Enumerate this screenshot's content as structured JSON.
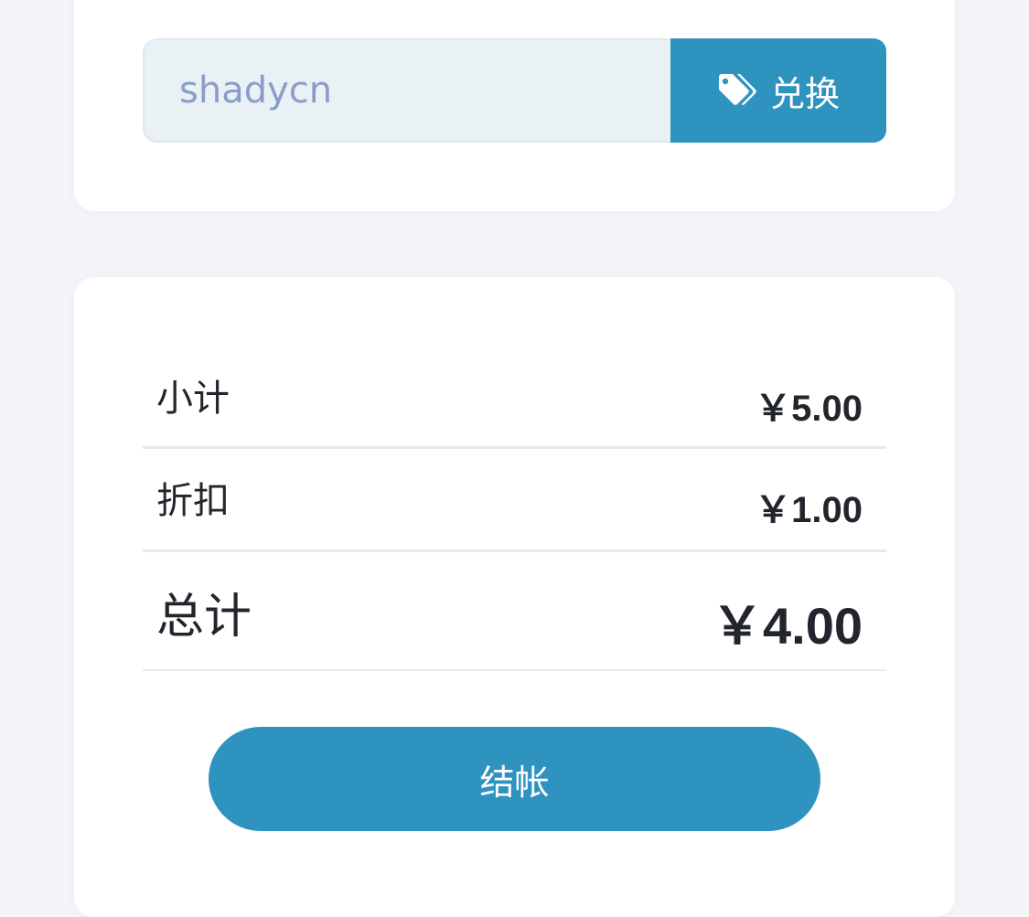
{
  "coupon": {
    "placeholder": "shadycn",
    "value": "",
    "redeem_label": "兑换",
    "redeem_icon": "tag-icon"
  },
  "summary": {
    "subtotal_label": "小计",
    "subtotal_value": "￥5.00",
    "discount_label": "折扣",
    "discount_value": "￥1.00",
    "total_label": "总计",
    "total_value": "￥4.00"
  },
  "checkout": {
    "label": "结帐"
  },
  "colors": {
    "accent": "#2e93bf",
    "page_background": "#f4f4fa",
    "input_background": "#e9f1f5",
    "placeholder": "#8a9dc8"
  }
}
